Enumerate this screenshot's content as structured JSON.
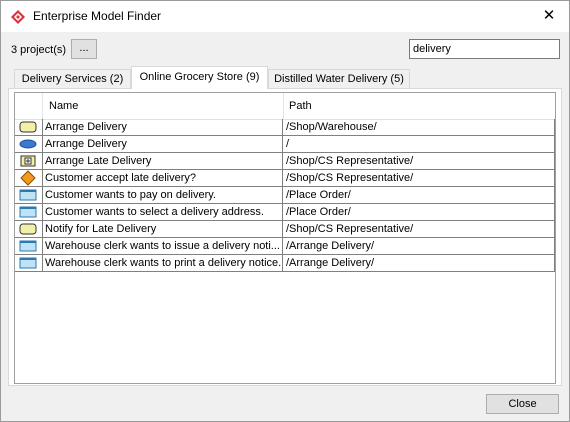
{
  "window": {
    "title": "Enterprise Model Finder",
    "close_glyph": "✕"
  },
  "toolbar": {
    "project_count": "3 project(s)",
    "more_label": "...",
    "search_value": "delivery"
  },
  "tabs": [
    {
      "label": "Delivery Services (2)",
      "active": false
    },
    {
      "label": "Online Grocery Store (9)",
      "active": true
    },
    {
      "label": "Distilled Water Delivery (5)",
      "active": false
    }
  ],
  "table": {
    "columns": [
      "Name",
      "Path"
    ],
    "rows": [
      {
        "icon": "process-icon",
        "name": "Arrange Delivery",
        "path": "/Shop/Warehouse/"
      },
      {
        "icon": "use-case-icon",
        "name": "Arrange Delivery",
        "path": "/"
      },
      {
        "icon": "subprocess-icon",
        "name": "Arrange Late Delivery",
        "path": "/Shop/CS Representative/"
      },
      {
        "icon": "gateway-icon",
        "name": "Customer accept late delivery?",
        "path": "/Shop/CS Representative/"
      },
      {
        "icon": "user-story-icon",
        "name": "Customer wants to pay on delivery.",
        "path": "/Place Order/"
      },
      {
        "icon": "user-story-icon",
        "name": "Customer wants to select a delivery address.",
        "path": "/Place Order/"
      },
      {
        "icon": "process-icon",
        "name": "Notify for Late Delivery",
        "path": "/Shop/CS Representative/"
      },
      {
        "icon": "user-story-icon",
        "name": "Warehouse clerk wants to issue a delivery noti...",
        "path": "/Arrange Delivery/"
      },
      {
        "icon": "user-story-icon",
        "name": "Warehouse clerk wants to print a delivery notice.",
        "path": "/Arrange Delivery/"
      }
    ]
  },
  "footer": {
    "close_label": "Close"
  }
}
